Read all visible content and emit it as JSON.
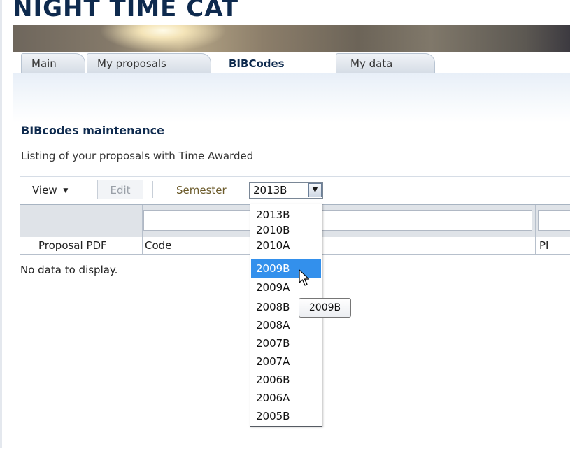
{
  "app": {
    "title": "NIGHT TIME CAT"
  },
  "tabs": [
    {
      "label": "Main",
      "active": false
    },
    {
      "label": "My proposals",
      "active": false
    },
    {
      "label": "BIBCodes",
      "active": true
    },
    {
      "label": "My data",
      "active": false
    }
  ],
  "page": {
    "section_title": "BIBcodes maintenance",
    "subtitle": "Listing of your proposals with Time Awarded"
  },
  "toolbar": {
    "view_label": "View",
    "edit_label": "Edit",
    "semester_label": "Semester",
    "semester_value": "2013B"
  },
  "table": {
    "columns": [
      "Proposal PDF",
      "Code",
      "PI"
    ],
    "empty_text": "No data to display."
  },
  "semester_dropdown": {
    "options": [
      "2013B",
      "2010B",
      "2010A",
      "2009B",
      "2009A",
      "2008B",
      "2008A",
      "2007B",
      "2007A",
      "2006B",
      "2006A",
      "2005B"
    ],
    "highlighted": "2009B"
  },
  "tooltip": {
    "text": "2009B"
  },
  "colors": {
    "accent": "#0e2a4e",
    "highlight": "#3390ec",
    "semester_label": "#6b5a2a"
  }
}
